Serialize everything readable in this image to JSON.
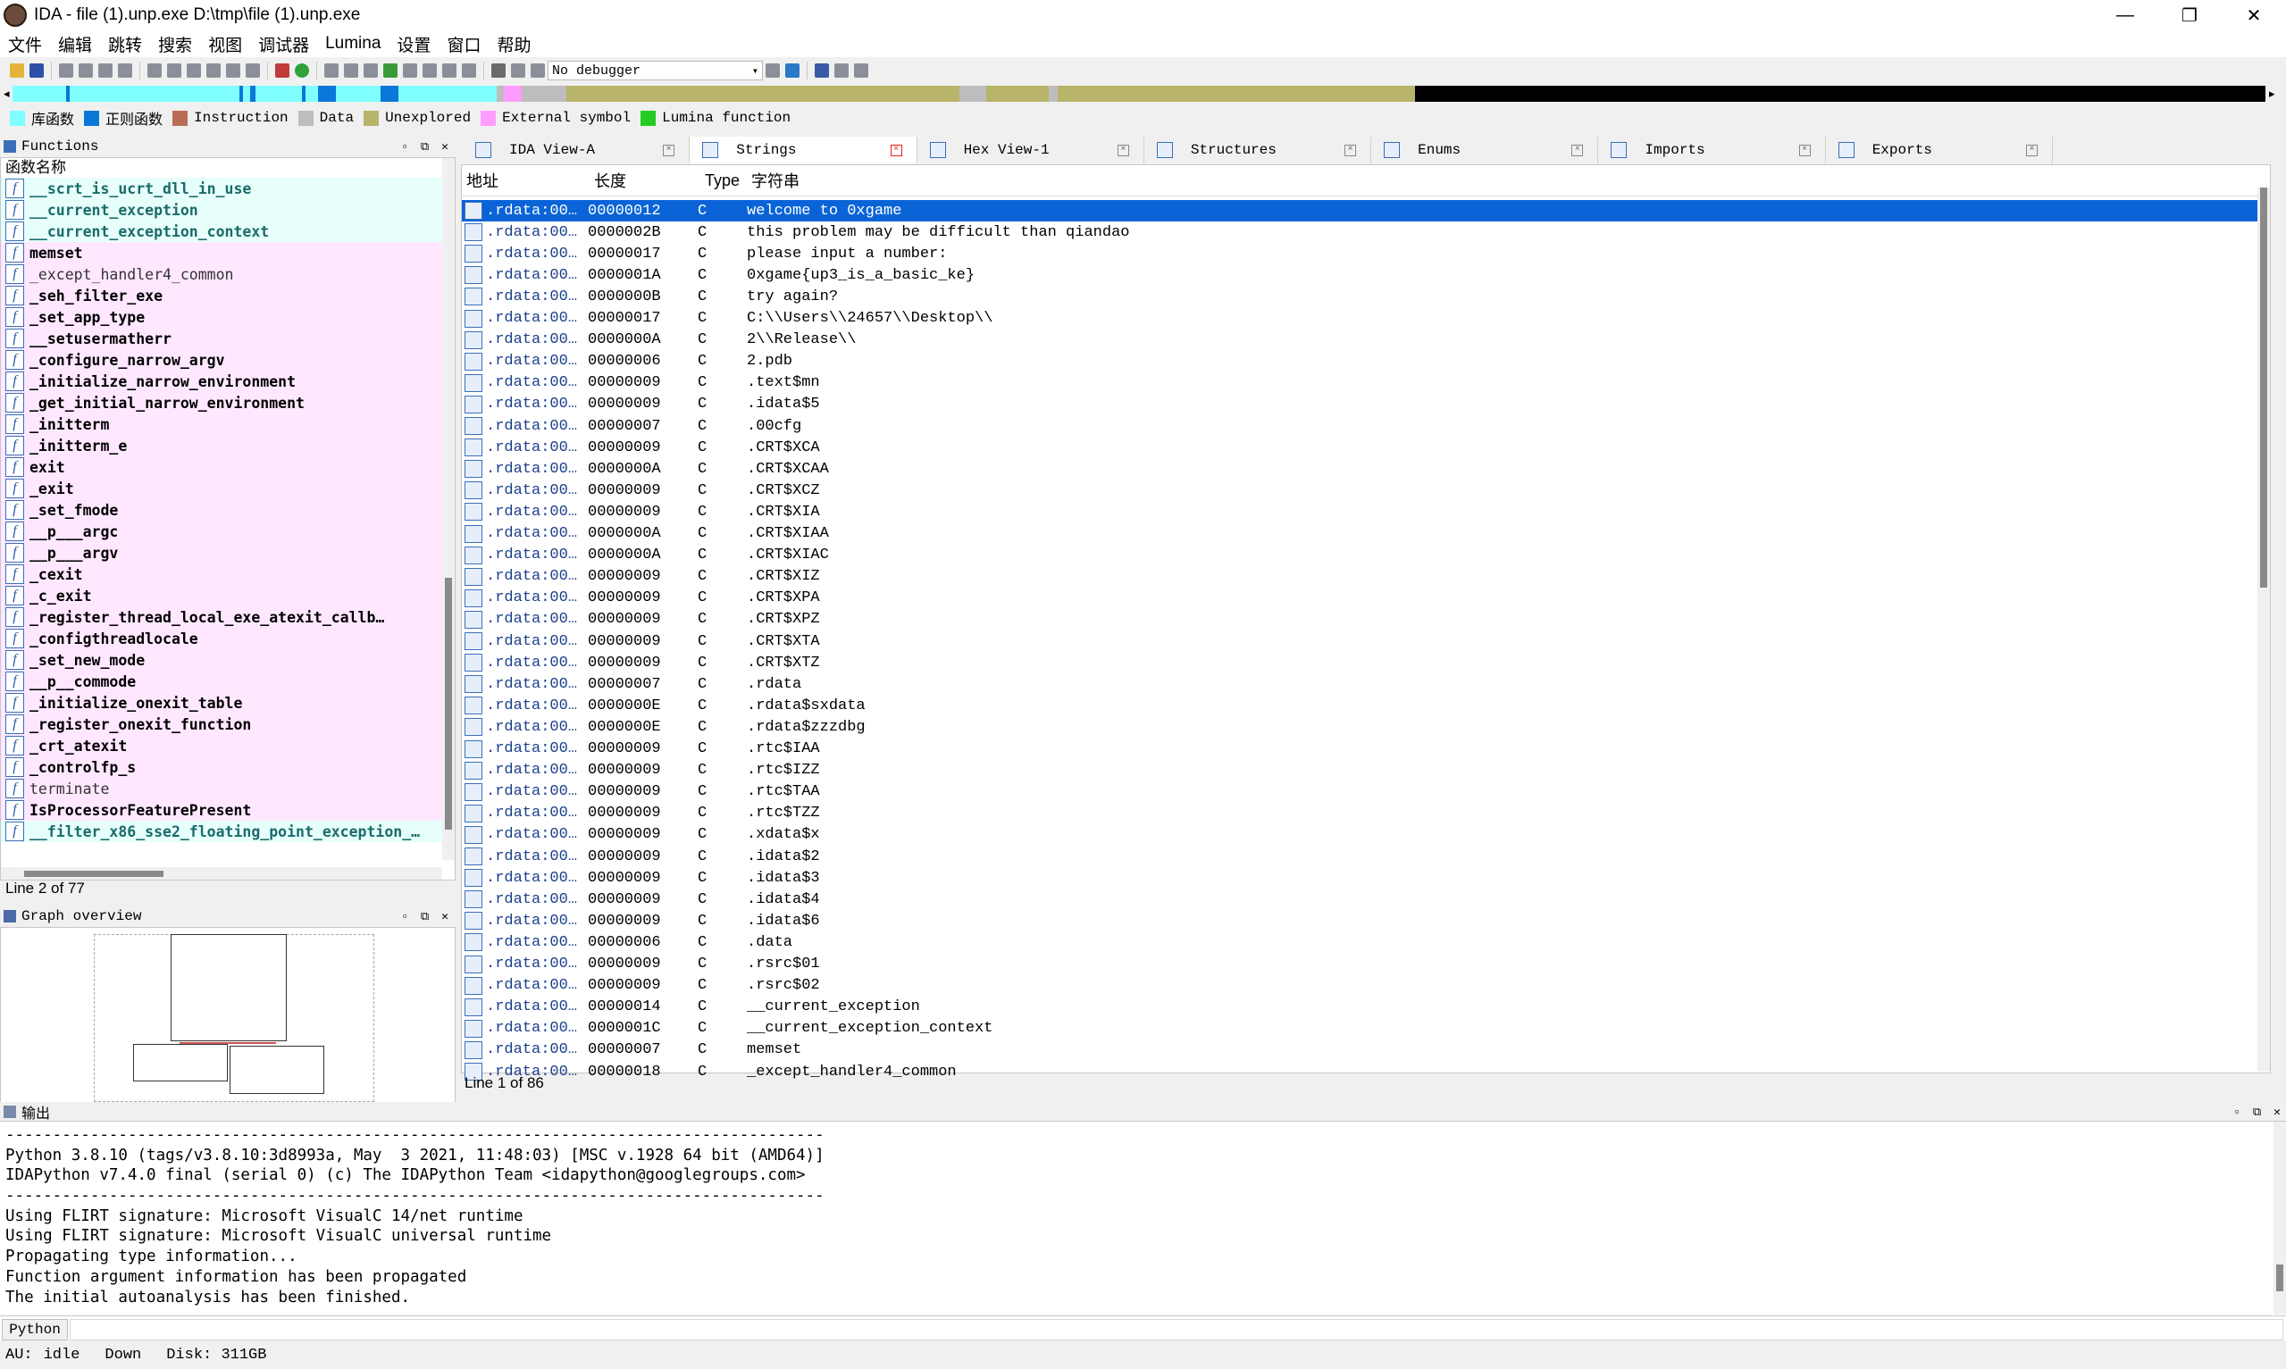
{
  "window": {
    "title": "IDA - file (1).unp.exe D:\\tmp\\file (1).unp.exe"
  },
  "menu": [
    "文件",
    "编辑",
    "跳转",
    "搜索",
    "视图",
    "调试器",
    "Lumina",
    "设置",
    "窗口",
    "帮助"
  ],
  "toolbar": {
    "debugger": "No debugger"
  },
  "colors": {
    "library": "#7fffff",
    "regular": "#0a78d8",
    "instruction": "#b86e56",
    "data": "#bdbdbd",
    "unexplored": "#b8b46a",
    "external": "#ff9cff",
    "lumina": "#22cc22",
    "selection": "#0a64d8"
  },
  "legend": [
    {
      "label": "库函数",
      "color": "#7fffff"
    },
    {
      "label": "正则函数",
      "color": "#0a78d8"
    },
    {
      "label": "Instruction",
      "color": "#b86e56"
    },
    {
      "label": "Data",
      "color": "#bdbdbd"
    },
    {
      "label": "Unexplored",
      "color": "#b8b46a"
    },
    {
      "label": "External symbol",
      "color": "#ff9cff"
    },
    {
      "label": "Lumina function",
      "color": "#22cc22"
    }
  ],
  "functions": {
    "title": "Functions",
    "header": "函数名称",
    "status": "Line 2 of 77",
    "items": [
      {
        "name": "__scrt_is_ucrt_dll_in_use",
        "kind": "lib"
      },
      {
        "name": "__current_exception",
        "kind": "lib"
      },
      {
        "name": "__current_exception_context",
        "kind": "lib"
      },
      {
        "name": "memset",
        "kind": "bold"
      },
      {
        "name": "_except_handler4_common",
        "kind": "thin"
      },
      {
        "name": "_seh_filter_exe",
        "kind": "bold"
      },
      {
        "name": "_set_app_type",
        "kind": "bold"
      },
      {
        "name": "__setusermatherr",
        "kind": "bold"
      },
      {
        "name": "_configure_narrow_argv",
        "kind": "bold"
      },
      {
        "name": "_initialize_narrow_environment",
        "kind": "bold"
      },
      {
        "name": "_get_initial_narrow_environment",
        "kind": "bold"
      },
      {
        "name": "_initterm",
        "kind": "bold"
      },
      {
        "name": "_initterm_e",
        "kind": "bold"
      },
      {
        "name": "exit",
        "kind": "bold"
      },
      {
        "name": "_exit",
        "kind": "bold"
      },
      {
        "name": "_set_fmode",
        "kind": "bold"
      },
      {
        "name": "__p___argc",
        "kind": "bold"
      },
      {
        "name": "__p___argv",
        "kind": "bold"
      },
      {
        "name": "_cexit",
        "kind": "bold"
      },
      {
        "name": "_c_exit",
        "kind": "bold"
      },
      {
        "name": "_register_thread_local_exe_atexit_callb…",
        "kind": "bold"
      },
      {
        "name": "_configthreadlocale",
        "kind": "bold"
      },
      {
        "name": "_set_new_mode",
        "kind": "bold"
      },
      {
        "name": "__p__commode",
        "kind": "bold"
      },
      {
        "name": "_initialize_onexit_table",
        "kind": "bold"
      },
      {
        "name": "_register_onexit_function",
        "kind": "bold"
      },
      {
        "name": "_crt_atexit",
        "kind": "bold"
      },
      {
        "name": "_controlfp_s",
        "kind": "bold"
      },
      {
        "name": "terminate",
        "kind": "thin"
      },
      {
        "name": "IsProcessorFeaturePresent",
        "kind": "bold"
      },
      {
        "name": "__filter_x86_sse2_floating_point_exception_…",
        "kind": "lib"
      }
    ]
  },
  "graph_overview": {
    "title": "Graph overview"
  },
  "tabs": [
    {
      "label": "IDA View-A",
      "active": false
    },
    {
      "label": "Strings",
      "active": true
    },
    {
      "label": "Hex View-1",
      "active": false
    },
    {
      "label": "Structures",
      "active": false
    },
    {
      "label": "Enums",
      "active": false
    },
    {
      "label": "Imports",
      "active": false
    },
    {
      "label": "Exports",
      "active": false
    }
  ],
  "strings": {
    "columns": [
      "地址",
      "长度",
      "Type",
      "字符串"
    ],
    "status": "Line 1 of 86",
    "rows": [
      {
        "addr": ".rdata:00…",
        "len": "00000012",
        "type": "C",
        "str": "welcome to 0xgame"
      },
      {
        "addr": ".rdata:00…",
        "len": "0000002B",
        "type": "C",
        "str": "this problem may be difficult than qiandao"
      },
      {
        "addr": ".rdata:00…",
        "len": "00000017",
        "type": "C",
        "str": "please input a number:"
      },
      {
        "addr": ".rdata:00…",
        "len": "0000001A",
        "type": "C",
        "str": "0xgame{up3_is_a_basic_ke}"
      },
      {
        "addr": ".rdata:00…",
        "len": "0000000B",
        "type": "C",
        "str": "try again?"
      },
      {
        "addr": ".rdata:00…",
        "len": "00000017",
        "type": "C",
        "str": "C:\\\\Users\\\\24657\\\\Desktop\\\\"
      },
      {
        "addr": ".rdata:00…",
        "len": "0000000A",
        "type": "C",
        "str": "2\\\\Release\\\\"
      },
      {
        "addr": ".rdata:00…",
        "len": "00000006",
        "type": "C",
        "str": "2.pdb"
      },
      {
        "addr": ".rdata:00…",
        "len": "00000009",
        "type": "C",
        "str": ".text$mn"
      },
      {
        "addr": ".rdata:00…",
        "len": "00000009",
        "type": "C",
        "str": ".idata$5"
      },
      {
        "addr": ".rdata:00…",
        "len": "00000007",
        "type": "C",
        "str": ".00cfg"
      },
      {
        "addr": ".rdata:00…",
        "len": "00000009",
        "type": "C",
        "str": ".CRT$XCA"
      },
      {
        "addr": ".rdata:00…",
        "len": "0000000A",
        "type": "C",
        "str": ".CRT$XCAA"
      },
      {
        "addr": ".rdata:00…",
        "len": "00000009",
        "type": "C",
        "str": ".CRT$XCZ"
      },
      {
        "addr": ".rdata:00…",
        "len": "00000009",
        "type": "C",
        "str": ".CRT$XIA"
      },
      {
        "addr": ".rdata:00…",
        "len": "0000000A",
        "type": "C",
        "str": ".CRT$XIAA"
      },
      {
        "addr": ".rdata:00…",
        "len": "0000000A",
        "type": "C",
        "str": ".CRT$XIAC"
      },
      {
        "addr": ".rdata:00…",
        "len": "00000009",
        "type": "C",
        "str": ".CRT$XIZ"
      },
      {
        "addr": ".rdata:00…",
        "len": "00000009",
        "type": "C",
        "str": ".CRT$XPA"
      },
      {
        "addr": ".rdata:00…",
        "len": "00000009",
        "type": "C",
        "str": ".CRT$XPZ"
      },
      {
        "addr": ".rdata:00…",
        "len": "00000009",
        "type": "C",
        "str": ".CRT$XTA"
      },
      {
        "addr": ".rdata:00…",
        "len": "00000009",
        "type": "C",
        "str": ".CRT$XTZ"
      },
      {
        "addr": ".rdata:00…",
        "len": "00000007",
        "type": "C",
        "str": ".rdata"
      },
      {
        "addr": ".rdata:00…",
        "len": "0000000E",
        "type": "C",
        "str": ".rdata$sxdata"
      },
      {
        "addr": ".rdata:00…",
        "len": "0000000E",
        "type": "C",
        "str": ".rdata$zzzdbg"
      },
      {
        "addr": ".rdata:00…",
        "len": "00000009",
        "type": "C",
        "str": ".rtc$IAA"
      },
      {
        "addr": ".rdata:00…",
        "len": "00000009",
        "type": "C",
        "str": ".rtc$IZZ"
      },
      {
        "addr": ".rdata:00…",
        "len": "00000009",
        "type": "C",
        "str": ".rtc$TAA"
      },
      {
        "addr": ".rdata:00…",
        "len": "00000009",
        "type": "C",
        "str": ".rtc$TZZ"
      },
      {
        "addr": ".rdata:00…",
        "len": "00000009",
        "type": "C",
        "str": ".xdata$x"
      },
      {
        "addr": ".rdata:00…",
        "len": "00000009",
        "type": "C",
        "str": ".idata$2"
      },
      {
        "addr": ".rdata:00…",
        "len": "00000009",
        "type": "C",
        "str": ".idata$3"
      },
      {
        "addr": ".rdata:00…",
        "len": "00000009",
        "type": "C",
        "str": ".idata$4"
      },
      {
        "addr": ".rdata:00…",
        "len": "00000009",
        "type": "C",
        "str": ".idata$6"
      },
      {
        "addr": ".rdata:00…",
        "len": "00000006",
        "type": "C",
        "str": ".data"
      },
      {
        "addr": ".rdata:00…",
        "len": "00000009",
        "type": "C",
        "str": ".rsrc$01"
      },
      {
        "addr": ".rdata:00…",
        "len": "00000009",
        "type": "C",
        "str": ".rsrc$02"
      },
      {
        "addr": ".rdata:00…",
        "len": "00000014",
        "type": "C",
        "str": "__current_exception"
      },
      {
        "addr": ".rdata:00…",
        "len": "0000001C",
        "type": "C",
        "str": "__current_exception_context"
      },
      {
        "addr": ".rdata:00…",
        "len": "00000007",
        "type": "C",
        "str": "memset"
      },
      {
        "addr": ".rdata:00…",
        "len": "00000018",
        "type": "C",
        "str": "_except_handler4_common"
      }
    ]
  },
  "output": {
    "title": "输出",
    "lines": [
      "---------------------------------------------------------------------------------------",
      "Python 3.8.10 (tags/v3.8.10:3d8993a, May  3 2021, 11:48:03) [MSC v.1928 64 bit (AMD64)]",
      "IDAPython v7.4.0 final (serial 0) (c) The IDAPython Team <idapython@googlegroups.com>",
      "---------------------------------------------------------------------------------------",
      "Using FLIRT signature: Microsoft VisualC 14/net runtime",
      "Using FLIRT signature: Microsoft VisualC universal runtime",
      "Propagating type information...",
      "Function argument information has been propagated",
      "The initial autoanalysis has been finished."
    ],
    "python_label": "Python"
  },
  "statusbar": {
    "au_label": "AU:",
    "au_state": "idle",
    "direction": "Down",
    "disk": "Disk: 311GB"
  }
}
